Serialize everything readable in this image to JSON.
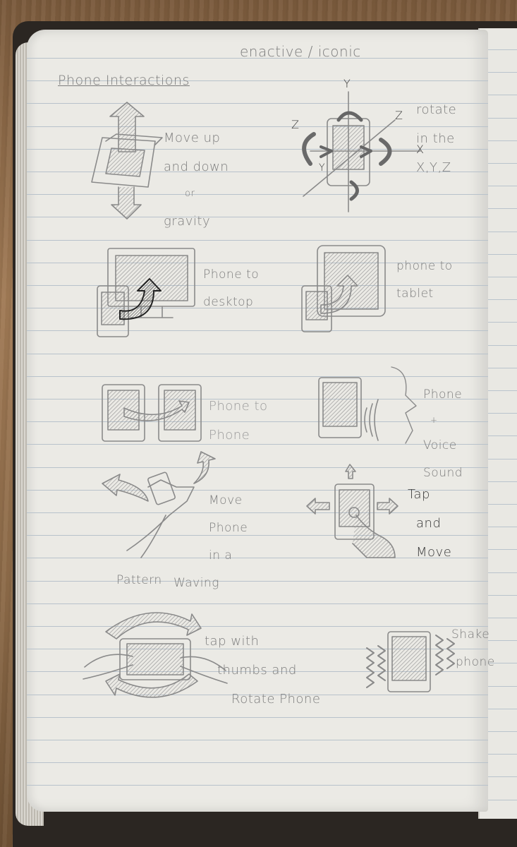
{
  "header": {
    "top_note": "enactive / iconic",
    "title": "Phone Interactions"
  },
  "sketches": [
    {
      "id": "move-up-down",
      "caption_lines": [
        "Move up",
        "and down",
        "or",
        "gravity"
      ]
    },
    {
      "id": "rotate-xyz",
      "caption_lines": [
        "rotate",
        "in the",
        "X,Y,Z"
      ],
      "axis_labels": [
        "Y",
        "Z",
        "X",
        "Z",
        "Y"
      ]
    },
    {
      "id": "phone-to-desktop",
      "caption_lines": [
        "Phone to",
        "desktop"
      ]
    },
    {
      "id": "phone-to-tablet",
      "caption_lines": [
        "phone to",
        "tablet"
      ]
    },
    {
      "id": "phone-to-phone",
      "caption_lines": [
        "Phone to",
        "Phone"
      ]
    },
    {
      "id": "phone-voice-sound",
      "caption_lines": [
        "Phone",
        "+",
        "Voice",
        "Sound"
      ]
    },
    {
      "id": "wave-pattern",
      "caption_lines": [
        "Move",
        "Phone",
        "in a",
        "Waving",
        "Pattern"
      ]
    },
    {
      "id": "tap-and-move",
      "caption_lines": [
        "Tap",
        "and",
        "Move"
      ]
    },
    {
      "id": "tap-thumbs-rotate",
      "caption_lines": [
        "tap with",
        "thumbs and",
        "Rotate Phone"
      ]
    },
    {
      "id": "shake-phone",
      "caption_lines": [
        "Shake",
        "phone"
      ]
    }
  ],
  "colors": {
    "paper": "#ebeae5",
    "rule_line": "#b8c2cb",
    "pencil": "#7d7d7d",
    "pencil_dark": "#3a3a3a"
  }
}
